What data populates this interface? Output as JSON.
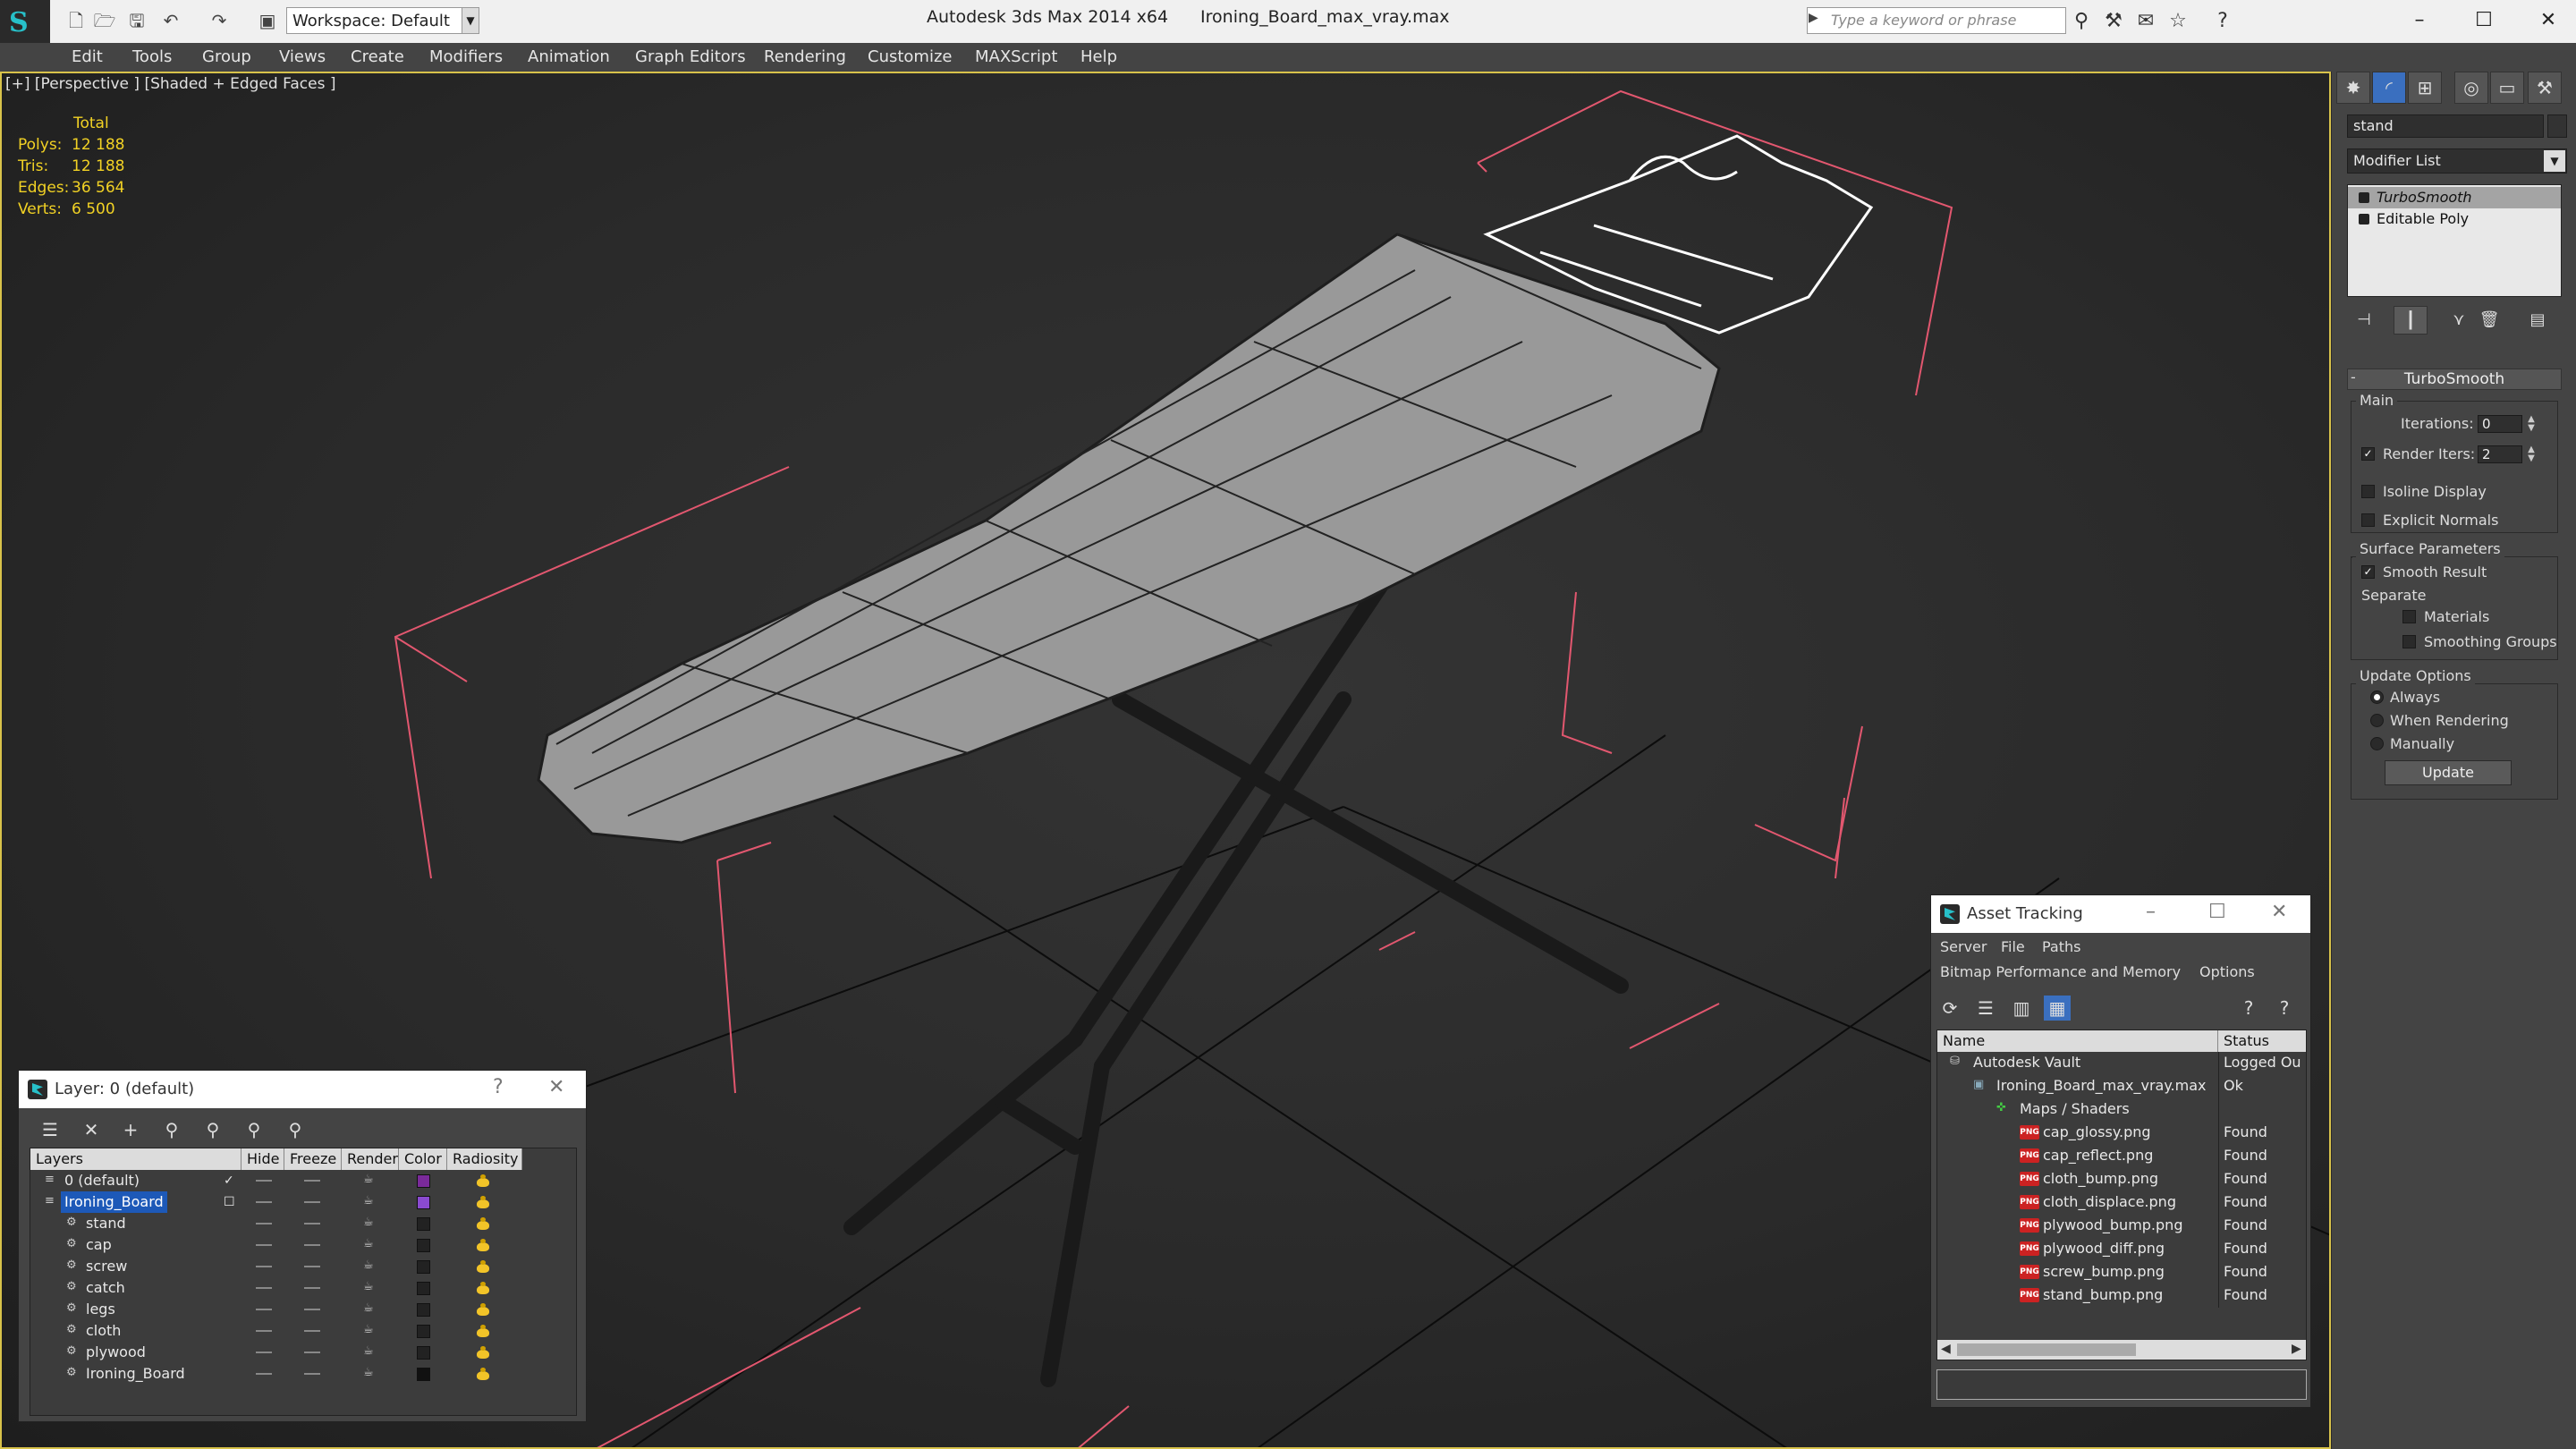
{
  "app": {
    "name": "Autodesk 3ds Max  2014 x64",
    "file": "Ironing_Board_max_vray.max",
    "workspace": "Workspace: Default",
    "search_placeholder": "Type a keyword or phrase"
  },
  "menu": [
    "Edit",
    "Tools",
    "Group",
    "Views",
    "Create",
    "Modifiers",
    "Animation",
    "Graph Editors",
    "Rendering",
    "Customize",
    "MAXScript",
    "Help"
  ],
  "viewport": {
    "label": "[+] [Perspective ] [Shaded + Edged Faces ]",
    "stats": {
      "header": "Total",
      "rows": [
        {
          "label": "Polys:",
          "value": "12 188"
        },
        {
          "label": "Tris:",
          "value": "12 188"
        },
        {
          "label": "Edges:",
          "value": "36 564"
        },
        {
          "label": "Verts:",
          "value": "6 500"
        }
      ]
    }
  },
  "command_panel": {
    "object_name": "stand",
    "modifier_list": "Modifier List",
    "stack": [
      "TurboSmooth",
      "Editable Poly"
    ],
    "turbosmooth": {
      "title": "TurboSmooth",
      "main": "Main",
      "iterations_label": "Iterations:",
      "iterations": "0",
      "render_iters_label": "Render Iters:",
      "render_iters": "2",
      "isoline": "Isoline Display",
      "explicit": "Explicit Normals",
      "surface_params": "Surface Parameters",
      "smooth_result": "Smooth Result",
      "separate": "Separate",
      "materials": "Materials",
      "smoothing_groups": "Smoothing Groups",
      "update_options": "Update Options",
      "always": "Always",
      "when_rendering": "When Rendering",
      "manually": "Manually",
      "update": "Update"
    }
  },
  "layer_dialog": {
    "title": "Layer: 0 (default)",
    "help": "?",
    "columns": [
      "Layers",
      "Hide",
      "Freeze",
      "Render",
      "Color",
      "Radiosity"
    ],
    "rows": [
      {
        "name": "0 (default)",
        "color": "#7a2a9a",
        "indent": 0
      },
      {
        "name": "Ironing_Board",
        "color": "#8a4ad0",
        "indent": 0
      },
      {
        "name": "stand",
        "color": "#222222",
        "indent": 1
      },
      {
        "name": "cap",
        "color": "#222222",
        "indent": 1
      },
      {
        "name": "screw",
        "color": "#222222",
        "indent": 1
      },
      {
        "name": "catch",
        "color": "#222222",
        "indent": 1
      },
      {
        "name": "legs",
        "color": "#222222",
        "indent": 1
      },
      {
        "name": "cloth",
        "color": "#222222",
        "indent": 1
      },
      {
        "name": "plywood",
        "color": "#222222",
        "indent": 1
      },
      {
        "name": "Ironing_Board",
        "color": "#111111",
        "indent": 1
      }
    ]
  },
  "asset_dialog": {
    "title": "Asset Tracking",
    "menu1": [
      "Server",
      "File",
      "Paths"
    ],
    "menu2": [
      "Bitmap Performance and Memory",
      "Options"
    ],
    "columns": [
      "Name",
      "Status"
    ],
    "rows": [
      {
        "name": "Autodesk Vault",
        "status": "Logged Ou",
        "indent": 0,
        "type": "vault"
      },
      {
        "name": "Ironing_Board_max_vray.max",
        "status": "Ok",
        "indent": 1,
        "type": "max"
      },
      {
        "name": "Maps / Shaders",
        "status": "",
        "indent": 2,
        "type": "maps"
      },
      {
        "name": "cap_glossy.png",
        "status": "Found",
        "indent": 3,
        "type": "png"
      },
      {
        "name": "cap_reflect.png",
        "status": "Found",
        "indent": 3,
        "type": "png"
      },
      {
        "name": "cloth_bump.png",
        "status": "Found",
        "indent": 3,
        "type": "png"
      },
      {
        "name": "cloth_displace.png",
        "status": "Found",
        "indent": 3,
        "type": "png"
      },
      {
        "name": "plywood_bump.png",
        "status": "Found",
        "indent": 3,
        "type": "png"
      },
      {
        "name": "plywood_diff.png",
        "status": "Found",
        "indent": 3,
        "type": "png"
      },
      {
        "name": "screw_bump.png",
        "status": "Found",
        "indent": 3,
        "type": "png"
      },
      {
        "name": "stand_bump.png",
        "status": "Found",
        "indent": 3,
        "type": "png"
      }
    ]
  }
}
